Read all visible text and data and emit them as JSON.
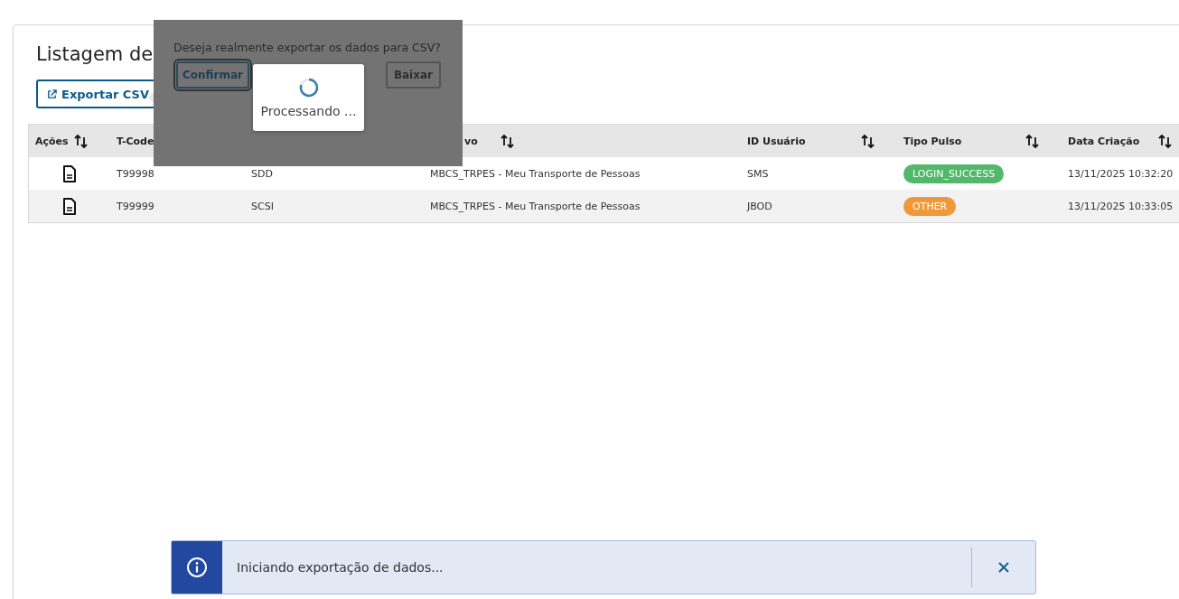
{
  "page": {
    "title": "Listagem de"
  },
  "toolbar": {
    "export_button": "Exportar CSV"
  },
  "table": {
    "columns": [
      {
        "label": "Ações",
        "sort_icon": true
      },
      {
        "label": "T-Code"
      },
      {},
      {
        "label": "vo",
        "sort_icon": true
      },
      {
        "label": "ID Usuário",
        "sort_icon": true
      },
      {
        "label": "Tipo Pulso",
        "sort_icon": true
      },
      {
        "label": "Data Criação",
        "sort_icon": true
      }
    ],
    "rows": [
      {
        "tcode": "T99998",
        "column_3": "SDD",
        "column_4": "MBCS_TRPES - Meu Transporte de Pessoas",
        "user": "SMS",
        "pulse": {
          "label": "LOGIN_SUCCESS",
          "color": "#52b86a"
        },
        "created": "13/11/2025 10:32:20"
      },
      {
        "tcode": "T99999",
        "column_3": "SCSI",
        "column_4": "MBCS_TRPES - Meu Transporte de Pessoas",
        "user": "JBOD",
        "pulse": {
          "label": "OTHER",
          "color": "#ee9a3a"
        },
        "created": "13/11/2025 10:33:05"
      }
    ]
  },
  "popover": {
    "question": "Deseja realmente exportar os dados para CSV?",
    "confirm_button": {
      "label": "Confirmar",
      "focused": true
    },
    "download_button": {
      "label": "Baixar",
      "disabled": true
    }
  },
  "loading": {
    "text": "Processando ..."
  },
  "toast": {
    "kind": "info",
    "message": "Iniciando exportação de dados..."
  }
}
